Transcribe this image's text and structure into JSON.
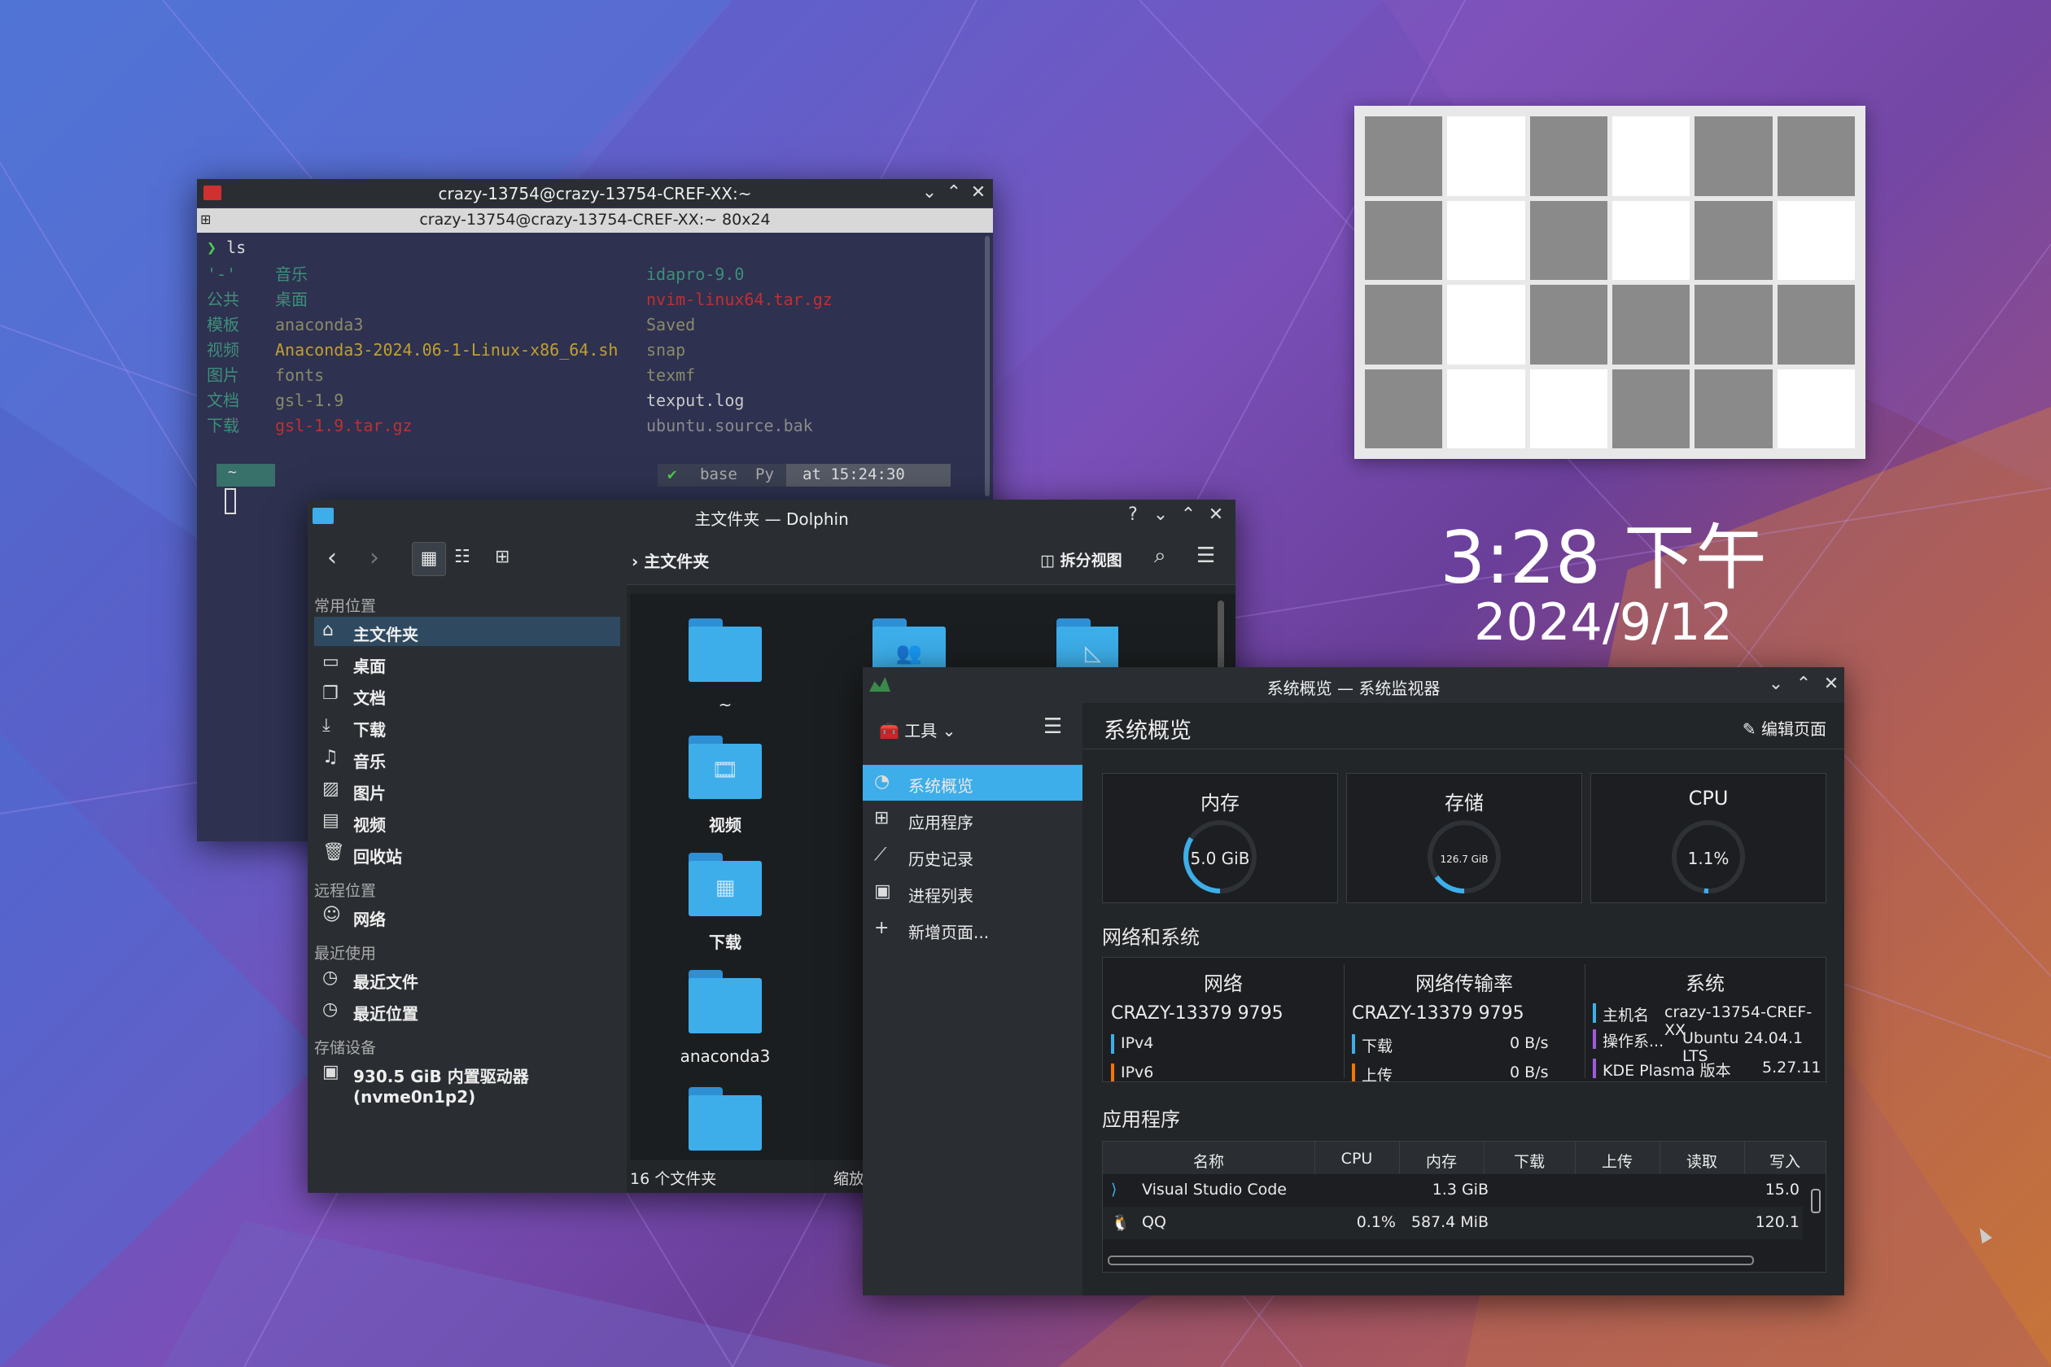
{
  "clock": {
    "time": "3:28 下午",
    "date": "2024/9/12"
  },
  "pager": {
    "cells": [
      0,
      1,
      0,
      1,
      0,
      0,
      0,
      1,
      0,
      1,
      0,
      1,
      0,
      1,
      0,
      0,
      0,
      0,
      0,
      1,
      1,
      0,
      0,
      1
    ]
  },
  "terminal": {
    "title": "crazy-13754@crazy-13754-CREF-XX:~",
    "tab": "crazy-13754@crazy-13754-CREF-XX:~ 80x24",
    "prompt_cmd": "ls",
    "prompt_symbol": "❯",
    "col1": [
      "'-'",
      "公共",
      "模板",
      "视频",
      "图片",
      "文档",
      "下载"
    ],
    "col2": [
      "音乐",
      "桌面",
      "anaconda3",
      "Anaconda3-2024.06-1-Linux-x86_64.sh",
      "fonts",
      "gsl-1.9",
      "gsl-1.9.tar.gz"
    ],
    "col3": [
      "idapro-9.0",
      "nvim-linux64.tar.gz",
      "Saved",
      "snap",
      "texmf",
      "texput.log",
      "ubuntu.source.bak"
    ],
    "status": {
      "dir": "~",
      "env": "base",
      "lang": "Py",
      "time": "at 15:24:30",
      "check": "✔"
    }
  },
  "dolphin": {
    "title": "主文件夹 — Dolphin",
    "breadcrumb": "主文件夹",
    "split_label": "拆分视图",
    "sections": {
      "common": "常用位置",
      "remote": "远程位置",
      "recent": "最近使用",
      "storage": "存储设备"
    },
    "places": [
      {
        "icon": "home-icon",
        "label": "主文件夹"
      },
      {
        "icon": "desktop-icon",
        "label": "桌面"
      },
      {
        "icon": "documents-icon",
        "label": "文档"
      },
      {
        "icon": "download-icon",
        "label": "下载"
      },
      {
        "icon": "music-icon",
        "label": "音乐"
      },
      {
        "icon": "pictures-icon",
        "label": "图片"
      },
      {
        "icon": "video-icon",
        "label": "视频"
      },
      {
        "icon": "trash-icon",
        "label": "回收站"
      }
    ],
    "remote": [
      {
        "icon": "network-icon",
        "label": "网络"
      }
    ],
    "recent": [
      {
        "icon": "recent-files-icon",
        "label": "最近文件"
      },
      {
        "icon": "recent-locations-icon",
        "label": "最近位置"
      }
    ],
    "storage": [
      {
        "icon": "drive-icon",
        "label": "930.5 GiB 内置驱动器 (nvme0n1p2)"
      }
    ],
    "folders": [
      "~",
      "视频",
      "下载",
      "anaconda3"
    ],
    "status": "16 个文件夹",
    "zoom_label": "缩放"
  },
  "sysmon": {
    "title": "系统概览 — 系统监视器",
    "tools_label": "工具",
    "page_title": "系统概览",
    "edit_label": "编辑页面",
    "nav": [
      "系统概览",
      "应用程序",
      "历史记录",
      "进程列表",
      "新增页面..."
    ],
    "memory": {
      "label": "内存",
      "value": "5.0 GiB",
      "fraction": 0.34
    },
    "storage": {
      "label": "存储",
      "value": "126.7 GiB",
      "fraction": 0.15
    },
    "cpu": {
      "label": "CPU",
      "value": "1.1%",
      "fraction": 0.011
    },
    "net_section": "网络和系统",
    "network": {
      "label": "网络",
      "name": "CRAZY-13379 9795",
      "row1": "IPv4",
      "row2": "IPv6"
    },
    "rate": {
      "label": "网络传输率",
      "name": "CRAZY-13379 9795",
      "down": "下载",
      "down_val": "0 B/s",
      "up": "上传",
      "up_val": "0 B/s"
    },
    "system": {
      "label": "系统",
      "host_k": "主机名",
      "host_v": "crazy-13754-CREF-XX",
      "os_k": "操作系...",
      "os_v": "Ubuntu 24.04.1 LTS",
      "kde_k": "KDE Plasma 版本",
      "kde_v": "5.27.11"
    },
    "apps_section": "应用程序",
    "columns": [
      "名称",
      "CPU",
      "内存",
      "下载",
      "上传",
      "读取",
      "写入"
    ],
    "apps": [
      {
        "name": "Visual Studio Code",
        "cpu": "",
        "mem": "1.3 GiB",
        "write": "15.0"
      },
      {
        "name": "QQ",
        "cpu": "0.1%",
        "mem": "587.4 MiB",
        "write": "120.1"
      }
    ]
  },
  "colors": {
    "accent": "#3daee9",
    "memory": "#3daee9",
    "storage": "#3daee9",
    "ipv4": "#3daee9",
    "purple": "#a05ae0",
    "orange": "#f67400"
  }
}
